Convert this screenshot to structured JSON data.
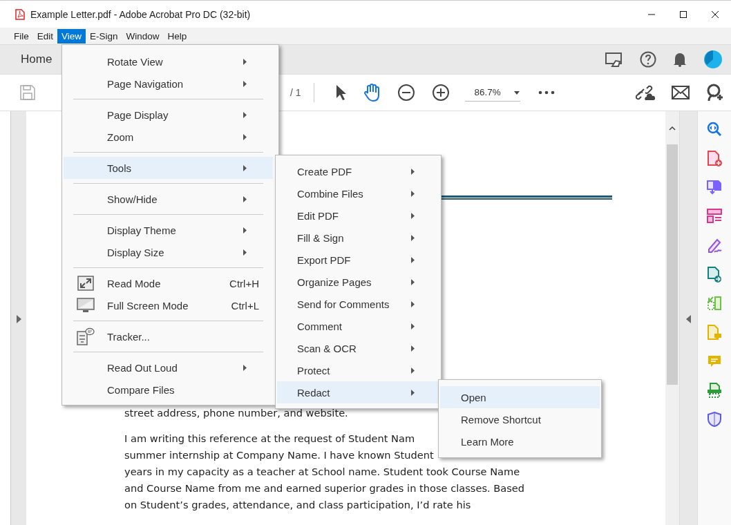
{
  "window": {
    "title": "Example Letter.pdf - Adobe Acrobat Pro DC (32-bit)"
  },
  "menu_bar": [
    {
      "label": "File",
      "selected": false
    },
    {
      "label": "Edit",
      "selected": false
    },
    {
      "label": "View",
      "selected": true
    },
    {
      "label": "E-Sign",
      "selected": false
    },
    {
      "label": "Window",
      "selected": false
    },
    {
      "label": "Help",
      "selected": false
    }
  ],
  "tabs": [
    {
      "label": "Home",
      "selected": false
    }
  ],
  "toolbar": {
    "page_total": "/ 1",
    "zoom": "86.7%"
  },
  "document": {
    "lines": [
      "street address, phone number, and website."
    ],
    "paragraph": [
      "I am writing this reference at the request of Student Nam",
      "summer internship at Company Name. I have known Student",
      "years in my capacity as a teacher at School name. Student took Course Name",
      "and Course Name from me and earned superior grades in those classes. Based",
      "on Student’s grades, attendance, and class participation, I’d rate his"
    ]
  },
  "view_menu": {
    "groups": [
      [
        {
          "label": "Rotate View",
          "submenu": true,
          "selected": false
        },
        {
          "label": "Page Navigation",
          "submenu": true,
          "selected": false
        }
      ],
      [
        {
          "label": "Page Display",
          "submenu": true,
          "selected": false
        },
        {
          "label": "Zoom",
          "submenu": true,
          "selected": false
        }
      ],
      [
        {
          "label": "Tools",
          "submenu": true,
          "selected": true
        }
      ],
      [
        {
          "label": "Show/Hide",
          "submenu": true,
          "selected": false
        }
      ],
      [
        {
          "label": "Display Theme",
          "submenu": true,
          "selected": false
        },
        {
          "label": "Display Size",
          "submenu": true,
          "selected": false
        }
      ],
      [
        {
          "label": "Read Mode",
          "shortcut": "Ctrl+H",
          "has_icon": true,
          "selected": false
        },
        {
          "label": "Full Screen Mode",
          "shortcut": "Ctrl+L",
          "has_icon": true,
          "selected": false
        }
      ],
      [
        {
          "label": "Tracker...",
          "has_icon": true,
          "selected": false
        }
      ],
      [
        {
          "label": "Read Out Loud",
          "submenu": true,
          "selected": false
        },
        {
          "label": "Compare Files",
          "selected": false
        }
      ]
    ]
  },
  "tools_menu": {
    "items": [
      {
        "label": "Create PDF",
        "submenu": true,
        "selected": false
      },
      {
        "label": "Combine Files",
        "submenu": true,
        "selected": false
      },
      {
        "label": "Edit PDF",
        "submenu": true,
        "selected": false
      },
      {
        "label": "Fill & Sign",
        "submenu": true,
        "selected": false
      },
      {
        "label": "Export PDF",
        "submenu": true,
        "selected": false
      },
      {
        "label": "Organize Pages",
        "submenu": true,
        "selected": false
      },
      {
        "label": "Send for Comments",
        "submenu": true,
        "selected": false
      },
      {
        "label": "Comment",
        "submenu": true,
        "selected": false
      },
      {
        "label": "Scan & OCR",
        "submenu": true,
        "selected": false
      },
      {
        "label": "Protect",
        "submenu": true,
        "selected": false
      },
      {
        "label": "Redact",
        "submenu": true,
        "selected": true
      }
    ]
  },
  "redact_menu": {
    "items": [
      {
        "label": "Open",
        "selected": true
      },
      {
        "label": "Remove Shortcut",
        "selected": false
      },
      {
        "label": "Learn More",
        "selected": false
      }
    ]
  }
}
